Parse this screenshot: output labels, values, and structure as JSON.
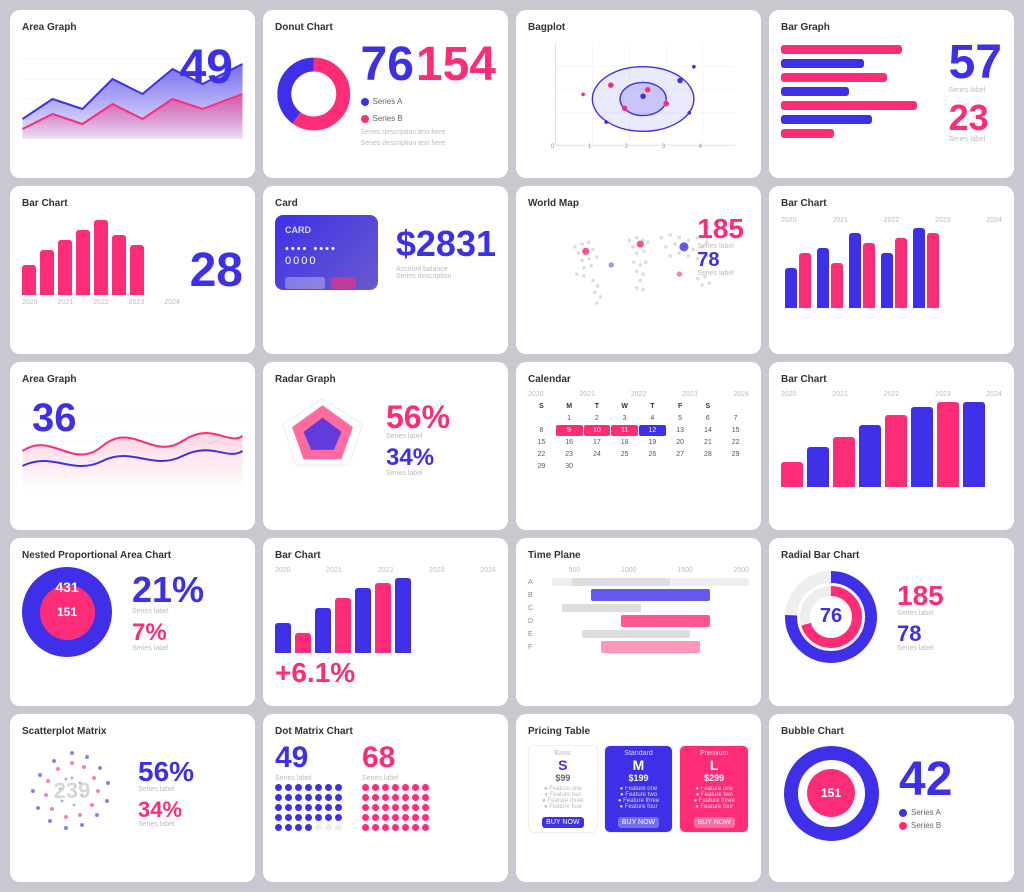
{
  "cards": [
    {
      "id": "area-graph",
      "title": "Area Graph",
      "value": "49"
    },
    {
      "id": "donut-chart",
      "title": "Donut Chart",
      "val1": "76",
      "val2": "154",
      "legend1": "Series A",
      "legend2": "Series B"
    },
    {
      "id": "bagplot",
      "title": "Bagplot"
    },
    {
      "id": "bar-graph",
      "title": "Bar Graph",
      "val1": "57",
      "val2": "23",
      "label1": "Series label",
      "label2": "Series label"
    },
    {
      "id": "bar-chart-1",
      "title": "Bar Chart",
      "value": "28"
    },
    {
      "id": "card",
      "title": "Card",
      "value": "$2831",
      "dots": "•••• •••• 0000"
    },
    {
      "id": "world-map",
      "title": "World Map",
      "val1": "185",
      "val2": "78",
      "label1": "Series label",
      "label2": "Series label"
    },
    {
      "id": "bar-chart-2",
      "title": "Bar Chart"
    },
    {
      "id": "area-graph-2",
      "title": "Area Graph",
      "value": "36"
    },
    {
      "id": "radar-graph",
      "title": "Radar Graph",
      "val1": "56%",
      "val2": "34%",
      "label1": "Series label",
      "label2": "Series label"
    },
    {
      "id": "calendar",
      "title": "Calendar"
    },
    {
      "id": "bar-chart-3",
      "title": "Bar Chart"
    },
    {
      "id": "nested",
      "title": "Nested Proportional Area Chart",
      "val1": "431",
      "val2": "151",
      "val3": "21%",
      "val4": "7%",
      "label3": "Series label",
      "label4": "Series label"
    },
    {
      "id": "bar-chart-4",
      "title": "Bar Chart",
      "value": "+6.1%"
    },
    {
      "id": "time-plane",
      "title": "Time Plane"
    },
    {
      "id": "radial",
      "title": "Radial Bar Chart",
      "val1": "76",
      "val2": "185",
      "val3": "78",
      "label2": "Series label",
      "label3": "Series label"
    },
    {
      "id": "scatter",
      "title": "Scatterplot Matrix",
      "val1": "56%",
      "val2": "34%",
      "val3": "239",
      "label1": "Series label",
      "label2": "Series label"
    },
    {
      "id": "dot-matrix",
      "title": "Dot Matrix Chart",
      "val1": "49",
      "val2": "68"
    },
    {
      "id": "pricing",
      "title": "Pricing Table"
    },
    {
      "id": "bubble",
      "title": "Bubble Chart",
      "value": "42",
      "val2": "151",
      "legend1": "Series A",
      "legend2": "Series B"
    }
  ]
}
